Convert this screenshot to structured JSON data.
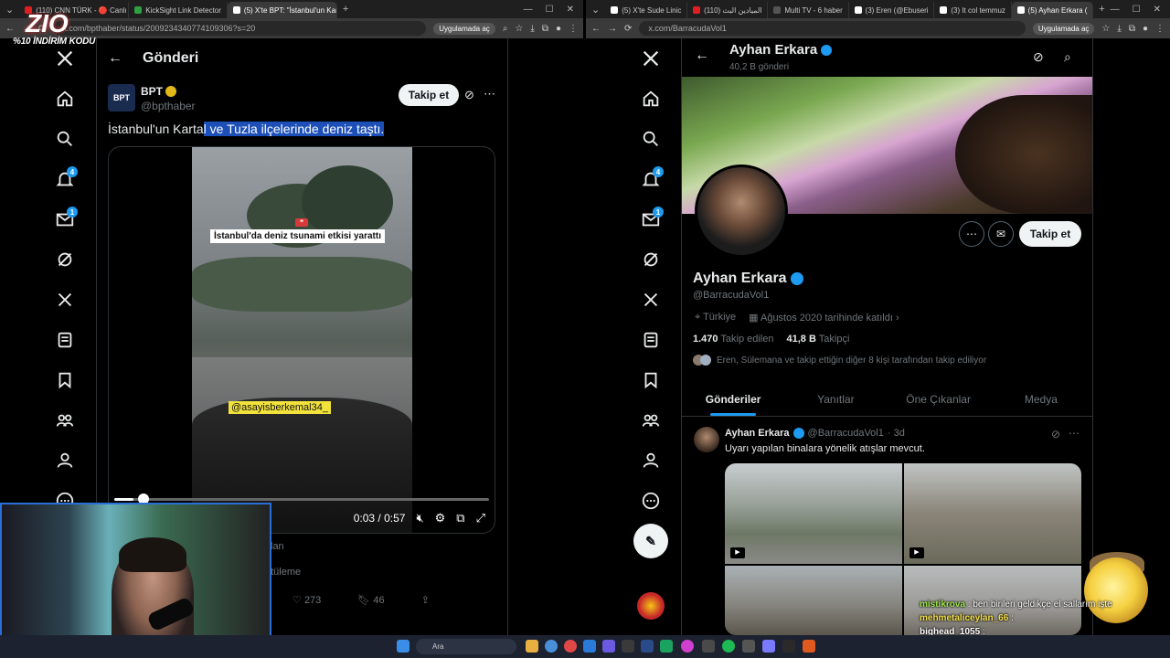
{
  "overlay": {
    "logo": "ZIO",
    "promo": "%10 İNDİRİM KODU"
  },
  "left_browser": {
    "tabs": [
      {
        "label": "(110) CNN TÜRK - 🔴 Canlı",
        "favicon": "#e02020"
      },
      {
        "label": "KickSight Link Detector",
        "favicon": "#2ea043"
      },
      {
        "label": "(5) X'te BPT: \"İstanbul'un Kartal\"",
        "favicon": "#ffffff",
        "active": true
      }
    ],
    "url": "x.com/bpthaber/status/2009234340774109306?s=20",
    "translate_pill": "Uygulamada aç"
  },
  "right_browser": {
    "tabs": [
      {
        "label": "(5) X'te Sude Linic",
        "favicon": "#ffffff"
      },
      {
        "label": "(110) الميادين البث",
        "favicon": "#e02020"
      },
      {
        "label": "Multi TV - 6 haber",
        "favicon": "#555555"
      },
      {
        "label": "(3) Eren (@Ebuseri",
        "favicon": "#ffffff"
      },
      {
        "label": "(3) It col temmuz",
        "favicon": "#ffffff"
      },
      {
        "label": "(5) Ayhan Erkara (",
        "favicon": "#ffffff",
        "active": true
      }
    ],
    "url": "x.com/BarracudaVol1",
    "translate_pill": "Uygulamada aç"
  },
  "nav_badges": {
    "notifications": "4",
    "messages": "1"
  },
  "post": {
    "header_title": "Gönderi",
    "author_name": "BPT",
    "author_handle": "@bpthaber",
    "avatar_text": "BPT",
    "follow_label": "Takip et",
    "text_plain": "İstanbul'un Karta",
    "text_highlighted": "l ve Tuzla ilçelerinde deniz taştı.",
    "video": {
      "caption": "İstanbul'da deniz tsunami etkisi yarattı",
      "watermark": "@asayisberkemal34_",
      "time": "0:03 / 0:57",
      "progress": 0.05
    },
    "partial_text_1": "lan",
    "partial_text_2": "ntüleme",
    "likes": "273",
    "bookmarks": "46"
  },
  "profile": {
    "header_name": "Ayhan Erkara",
    "post_count": "40,2 B gönderi",
    "name": "Ayhan Erkara",
    "handle": "@BarracudaVol1",
    "location": "Türkiye",
    "joined": "Ağustos 2020 tarihinde katıldı",
    "following_count": "1.470",
    "following_label": "Takip edilen",
    "followers_count": "41,8 B",
    "followers_label": "Takipçi",
    "mutual_text": "Eren, Sülemana ve takip ettiğin diğer 8 kişi tarafından takip ediliyor",
    "follow_label": "Takip et",
    "tabs": [
      "Gönderiler",
      "Yanıtlar",
      "Öne Çıkanlar",
      "Medya"
    ],
    "tweet": {
      "name": "Ayhan Erkara",
      "handle": "@BarracudaVol1",
      "time": "· 3d",
      "text": "Uyarı yapılan binalara yönelik atışlar mevcut."
    }
  },
  "chat": [
    {
      "user": "mistikrova",
      "msg": ": ben birileri geldikçe el sallarım işte"
    },
    {
      "user": "mehmetaliceylan_66",
      "msg": ":"
    },
    {
      "user": "bighead_1055",
      "msg": ":"
    }
  ],
  "taskbar": {
    "search_placeholder": "Ara"
  },
  "colors": {
    "accent": "#1d9bf0",
    "verified_gold": "#e2b719",
    "verified_blue": "#1d9bf0",
    "highlight": "#1d4fb8"
  }
}
